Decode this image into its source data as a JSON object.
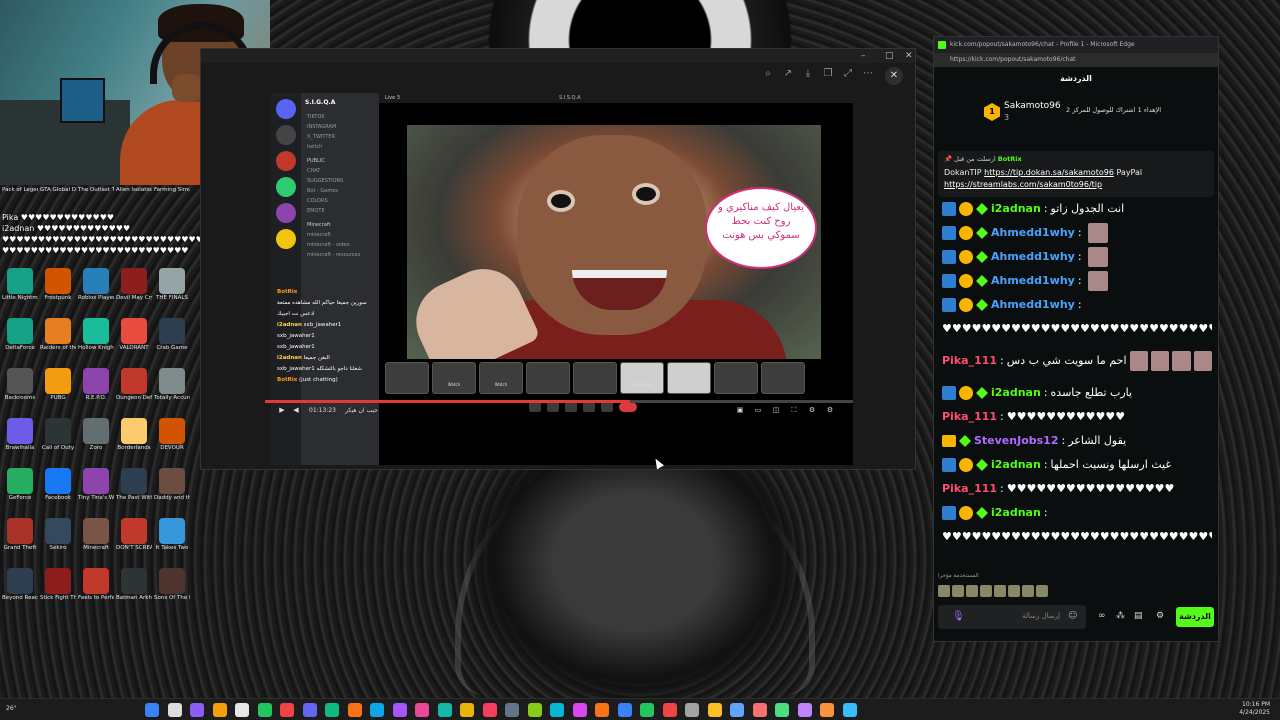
{
  "desktop": {
    "icons": [
      {
        "label": "Pack of Legends",
        "color": "#c0392b"
      },
      {
        "label": "GTA Global Domination",
        "color": "#7f8c8d"
      },
      {
        "label": "The Outlast Trials",
        "color": "#34495e"
      },
      {
        "label": "Alien Isolation",
        "color": "#2c3e50"
      },
      {
        "label": "Farming Simulator",
        "color": "#27ae60"
      },
      {
        "label": "Cooking Simulator",
        "color": "#e67e22"
      },
      {
        "label": "Shadows Tree",
        "color": "#2ecc71"
      },
      {
        "label": "Resident Evil",
        "color": "#8e44ad"
      },
      {
        "label": "Phasmophobia",
        "color": "#555"
      },
      {
        "label": "Escape Academy",
        "color": "#c0392b"
      },
      {
        "label": "Little Nightmares",
        "color": "#16a085"
      },
      {
        "label": "Frostpunk",
        "color": "#d35400"
      },
      {
        "label": "Roblox Player",
        "color": "#2980b9"
      },
      {
        "label": "Devil May Cry 5",
        "color": "#8e1d1d"
      },
      {
        "label": "THE FINALS",
        "color": "#95a5a6"
      },
      {
        "label": "DeltaForce",
        "color": "#16a085"
      },
      {
        "label": "Raiders of the Broken Planet",
        "color": "#e67e22"
      },
      {
        "label": "Hollow Knight Silksong",
        "color": "#1abc9c"
      },
      {
        "label": "VALORANT",
        "color": "#e74c3c"
      },
      {
        "label": "Crab Game",
        "color": "#2c3e50"
      },
      {
        "label": "Backrooms",
        "color": "#555"
      },
      {
        "label": "PUBG",
        "color": "#f39c12"
      },
      {
        "label": "R.E.P.O.",
        "color": "#8e44ad"
      },
      {
        "label": "Dungeon Defenders",
        "color": "#c0392b"
      },
      {
        "label": "Totally Accurate",
        "color": "#7f8c8d"
      },
      {
        "label": "Brawlhalla",
        "color": "#6c5ce7"
      },
      {
        "label": "Call of Duty",
        "color": "#2d3436"
      },
      {
        "label": "Zoro",
        "color": "#636e72"
      },
      {
        "label": "Borderlands",
        "color": "#fdcb6e"
      },
      {
        "label": "DEVOUR",
        "color": "#d35400"
      },
      {
        "label": "GeForce",
        "color": "#27ae60"
      },
      {
        "label": "Facebook",
        "color": "#1877f2"
      },
      {
        "label": "Tiny Tina's Wonderlands",
        "color": "#8e44ad"
      },
      {
        "label": "The Past Within",
        "color": "#2c3e50"
      },
      {
        "label": "Daddy and the Dark",
        "color": "#6d4c41"
      },
      {
        "label": "Grand Theft",
        "color": "#a93226"
      },
      {
        "label": "Sekiro",
        "color": "#34495e"
      },
      {
        "label": "Minecraft",
        "color": "#795548"
      },
      {
        "label": "DON'T SCREAM",
        "color": "#c0392b"
      },
      {
        "label": "It Takes Two",
        "color": "#3498db"
      },
      {
        "label": "Beyond Reach",
        "color": "#2c3e50"
      },
      {
        "label": "Stick Fight The Game",
        "color": "#8e1d1d"
      },
      {
        "label": "Feels to Perfection",
        "color": "#c0392b"
      },
      {
        "label": "Batman Arkham",
        "color": "#2d3436"
      },
      {
        "label": "Sons Of The Forest",
        "color": "#4e342e"
      }
    ]
  },
  "overlay_chat": {
    "lines": [
      "Pika  ♥♥♥♥♥♥♥♥♥♥♥♥♥",
      "i2adnan  ♥♥♥♥♥♥♥♥♥♥♥♥♥",
      "♥♥♥♥♥♥♥♥♥♥♥♥♥♥♥♥♥♥♥♥♥♥♥♥♥♥♥♥♥♥",
      "♥♥♥♥♥♥♥♥♥♥♥♥♥♥♥♥♥♥♥♥♥♥♥♥♥♥"
    ]
  },
  "player": {
    "discord": {
      "server_name": "S.I.G.Q.A",
      "call_title": "S.I.S.Q.A",
      "live_tab": "Live 3",
      "channels": [
        "TIKTOK",
        "INSTAGRAM",
        "X_TWITTER",
        "twitch",
        "CHAT",
        "SUGGESTIONS",
        "Bot - Games",
        "COLORS",
        "EMOTE",
        "minecraft",
        "minecraft - video",
        "minecraft - resources"
      ],
      "categories": [
        "PUBLIC",
        "Minecraft"
      ],
      "speech_bubble": "يعيال كيف مناكيري و روح كنت بحط سموكي بس هونت",
      "thumbs": [
        "",
        "Watch",
        "Watch",
        "",
        "",
        "Abu Sultan",
        "",
        "",
        "",
        "",
        ""
      ],
      "chat_overlay": [
        {
          "name": "BotRix",
          "text": ""
        },
        {
          "name": "",
          "text": "سورين جميعا حياكم الله مشاهده ممتعة"
        },
        {
          "name": "",
          "text": "ادعس نت اجيبك"
        },
        {
          "name": "i2adnan",
          "text": "sxb_jawaher1"
        },
        {
          "name": "",
          "text": "sxb_jawaher1"
        },
        {
          "name": "",
          "text": "sxb_jawaher1"
        },
        {
          "name": "i2adnan",
          "text": "البقن جميعا"
        },
        {
          "name": "",
          "text": "sxb_jawaher1 شغلنا داجو بالتشكله"
        },
        {
          "name": "BotRix",
          "text": "(just chatting)"
        }
      ],
      "time": "01:13:23",
      "stream_title": "جيب ان هيكر"
    }
  },
  "edge": {
    "title": "kick.com/popout/sakamoto96/chat - Profile 1 - Microsoft Edge",
    "url": "https://kick.com/popout/sakamoto96/chat",
    "chat_header": "الدردشة",
    "sub_goal": {
      "user": "Sakamoto96",
      "count": "3",
      "text": "الإهداء 1 اشتراك للوصول للمركز 2"
    },
    "pinned": {
      "by_label": "ارسلت من قبل",
      "bot_name": "BotRix",
      "line1_prefix": "DokanTIP",
      "link1": "https://tip.dokan.sa/sakamoto96",
      "line1_suffix": "PayPal",
      "link2": "https://streamlabs.com/sakam0to96/tip"
    },
    "messages": [
      {
        "user": "i2adnan",
        "color": "#53fc18",
        "text": "انت الجدول زاتو",
        "badges": [
          "b1",
          "b2",
          "b3"
        ],
        "emotes": 0
      },
      {
        "user": "Ahmedd1why",
        "color": "#4aa3ff",
        "text": "",
        "badges": [
          "b1",
          "b2",
          "b3"
        ],
        "emotes": 1
      },
      {
        "user": "Ahmedd1why",
        "color": "#4aa3ff",
        "text": "",
        "badges": [
          "b1",
          "b2",
          "b3"
        ],
        "emotes": 1
      },
      {
        "user": "Ahmedd1why",
        "color": "#4aa3ff",
        "text": "",
        "badges": [
          "b1",
          "b2",
          "b3"
        ],
        "emotes": 1
      },
      {
        "user": "Ahmedd1why",
        "color": "#4aa3ff",
        "text": "",
        "badges": [
          "b1",
          "b2",
          "b3"
        ],
        "emotes": 0
      },
      {
        "user": "",
        "color": "#fff",
        "text": "♥♥♥♥♥♥♥♥♥♥♥♥♥♥♥♥♥♥♥♥♥♥♥♥♥♥♥♥♥♥♥♥♥♥♥♥♥♥♥♥♥",
        "badges": [],
        "emotes": 0
      },
      {
        "user": "Pika_111",
        "color": "#ff4d6d",
        "text": "احم ما سويت شي ب دس",
        "badges": [],
        "emotes": 4
      },
      {
        "user": "i2adnan",
        "color": "#53fc18",
        "text": "يارب تطلع جاسده",
        "badges": [
          "b1",
          "b2",
          "b3"
        ],
        "emotes": 0
      },
      {
        "user": "Pika_111",
        "color": "#ff4d6d",
        "text": "♥♥♥♥♥♥♥♥♥♥♥♥",
        "badges": [],
        "emotes": 0
      },
      {
        "user": "StevenJobs12",
        "color": "#b06cff",
        "text": "يقول الشاعر",
        "badges": [
          "b4",
          "b3"
        ],
        "emotes": 0
      },
      {
        "user": "i2adnan",
        "color": "#53fc18",
        "text": "غيث ارسلها ونسيت احملها",
        "badges": [
          "b1",
          "b2",
          "b3"
        ],
        "emotes": 0
      },
      {
        "user": "Pika_111",
        "color": "#ff4d6d",
        "text": "♥♥♥♥♥♥♥♥♥♥♥♥♥♥♥♥♥",
        "badges": [],
        "emotes": 0
      },
      {
        "user": "i2adnan",
        "color": "#53fc18",
        "text": "",
        "badges": [
          "b1",
          "b2",
          "b3"
        ],
        "emotes": 0
      },
      {
        "user": "",
        "color": "#fff",
        "text": "♥♥♥♥♥♥♥♥♥♥♥♥♥♥♥♥♥♥♥♥♥♥♥♥♥♥♥♥♥♥♥♥♥♥♥♥♥♥♥♥♥",
        "badges": [],
        "emotes": 0
      }
    ],
    "recent_emotes_label": "المستخدمة مؤخرا",
    "input_placeholder": "إرسال رسالة",
    "send_label": "الدردشة"
  },
  "taskbar": {
    "weather": "26°",
    "time": "10:16 PM",
    "date": "4/24/2025"
  }
}
